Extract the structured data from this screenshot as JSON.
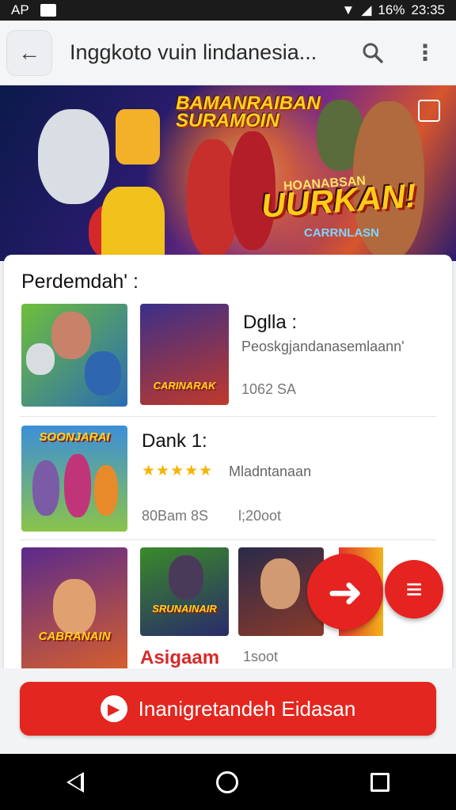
{
  "status_bar": {
    "left_text": "AP",
    "right_text": "16%",
    "time": "23:35"
  },
  "app_bar": {
    "title": "Inggkoto vuin  lindanesia..."
  },
  "hero": {
    "top_line1": "BAMANRAIBAN",
    "top_line2": "SURAMOIN",
    "small1": "HOANABSAN",
    "big": "UURKAN!",
    "small2": "CARRNLASN"
  },
  "section": {
    "title": "Perdemdah' :"
  },
  "items": [
    {
      "title": "Dglla :",
      "subtitle": "Peoskgjandanasemlaann'",
      "meta": "1062 SA",
      "thumb1": "",
      "thumb2": "CARINARAK"
    },
    {
      "title": "Dank 1:",
      "rating_stars": "★★★★★",
      "subtitle": "Mladntanaan",
      "meta1": "80Bam 8S",
      "meta2": "l;20oot",
      "thumb1": "SOONJARAI"
    },
    {
      "title": "Asigaam",
      "meta": "1soot",
      "thumb1": "CABRANAIN",
      "thumb2": "SRUNAINAIR"
    }
  ],
  "cta": {
    "label": "Inanigretandeh Eidasan"
  },
  "colors": {
    "accent": "#e3261f",
    "hero_text": "#ffd21f"
  },
  "icons": {
    "back": "arrow-left-icon",
    "search": "search-icon",
    "more": "more-vert-icon",
    "fab1": "arrow-right-icon",
    "fab2": "chat-icon"
  }
}
